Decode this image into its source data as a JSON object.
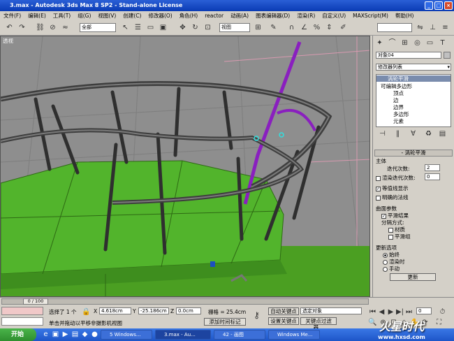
{
  "window": {
    "title": "3.max - Autodesk 3ds Max 8 SP2 - Stand-alone License"
  },
  "menu": [
    "文件(F)",
    "编辑(E)",
    "工具(T)",
    "组(G)",
    "视图(V)",
    "创建(C)",
    "修改器(O)",
    "角色(H)",
    "reactor",
    "动画(A)",
    "图表编辑器(D)",
    "渲染(R)",
    "自定义(U)",
    "MAXScript(M)",
    "帮助(H)"
  ],
  "toolbar": {
    "selection_filter": "全部",
    "coord_system": "视图",
    "named_selection": ""
  },
  "viewport": {
    "label": "透视"
  },
  "panel": {
    "object_name": "对象04",
    "modifier_list": "修改器列表",
    "stack": [
      {
        "label": "涡轮平滑",
        "selected": true
      },
      {
        "label": "可编辑多边形",
        "selected": false
      },
      {
        "label": "顶点",
        "selected": false
      },
      {
        "label": "边",
        "selected": false
      },
      {
        "label": "边界",
        "selected": false
      },
      {
        "label": "多边形",
        "selected": false
      },
      {
        "label": "元素",
        "selected": false
      }
    ],
    "rollout_title": "涡轮平滑",
    "main_label": "主体",
    "iterations_label": "迭代次数:",
    "iterations_value": "2",
    "render_iters_label": "渲染迭代次数:",
    "render_iters_value": "0",
    "isoline_label": "等值线显示",
    "explicit_normals_label": "明确的法线",
    "surface_label": "曲面参数",
    "smooth_result_label": "平滑结果",
    "separate_label": "分隔方式:",
    "material_label": "材质",
    "smoothing_groups_label": "平滑组",
    "update_label": "更新选项",
    "update_always": "始终",
    "update_render": "渲染时",
    "update_manual": "手动",
    "update_button": "更新"
  },
  "status": {
    "frame": "0 / 100",
    "selected": "选择了 1 个",
    "x_label": "X",
    "x_value": "4.618cm",
    "y_label": "Y",
    "y_value": "-25.186cm",
    "z_label": "Z",
    "z_value": "0.0cm",
    "grid": "栅格 = 25.4cm",
    "prompt": "单击并拖动以平移非摄影机视图",
    "add_time_tag": "添加时间标记",
    "auto_key": "自动关键点",
    "set_key": "设置关键点",
    "selected_object": "选定对象",
    "key_filters": "关键点过滤器...",
    "frame_field": "0"
  },
  "taskbar": {
    "start": "开始",
    "tasks": [
      "5 Windows...",
      "3.max - Au...",
      "42 - 画图",
      "Windows Me..."
    ],
    "watermark": "火星时代",
    "watermark_url": "www.hxsd.com"
  },
  "colors": {
    "title": "#0a3bb4",
    "green": "#4fb82a",
    "purple": "#8a1fbf",
    "pole": "#3a3a3a"
  }
}
